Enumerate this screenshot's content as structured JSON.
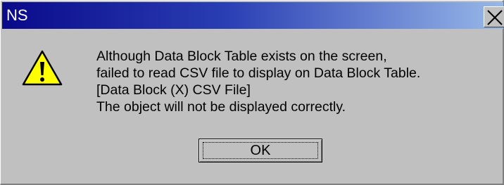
{
  "window": {
    "title": "NS",
    "close_icon": "close-icon",
    "accent_color": "#0a0a8a"
  },
  "dialog": {
    "icon": "warning-icon",
    "icon_color": "#ffff00",
    "message_lines": [
      "Although Data Block Table exists on the screen,",
      "failed to read CSV file to display on Data Block Table.",
      "[Data Block (X) CSV File]",
      "The object will not be displayed correctly."
    ],
    "ok_label": "OK"
  }
}
